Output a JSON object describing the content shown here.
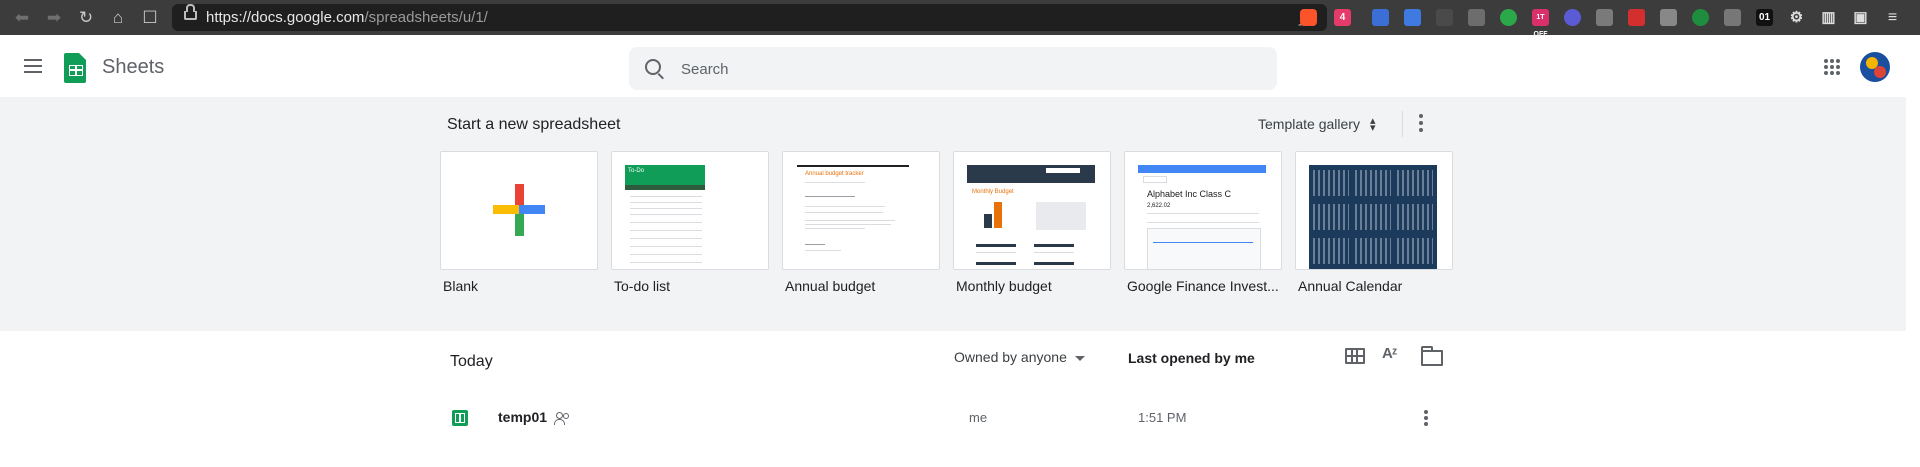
{
  "browser": {
    "url_host": "https://docs.google.com",
    "url_path": "/spreadsheets/u/1/",
    "extension_badges": {
      "brave_alerts": "4",
      "toggle": "1T OFF",
      "counter": "01"
    }
  },
  "header": {
    "app_name": "Sheets",
    "search_placeholder": "Search",
    "icons": [
      "menu-icon",
      "sheets-logo",
      "search-icon",
      "apps-grid-icon",
      "account-avatar"
    ]
  },
  "templates": {
    "title": "Start a new spreadsheet",
    "gallery_label": "Template gallery",
    "items": [
      {
        "label": "Blank"
      },
      {
        "label": "To-do list",
        "thumb_heading": "To-Do"
      },
      {
        "label": "Annual budget",
        "thumb_heading": "Annual budget tracker"
      },
      {
        "label": "Monthly budget",
        "thumb_heading": "Monthly Budget"
      },
      {
        "label": "Google Finance Invest...",
        "thumb_heading": "Alphabet Inc Class C",
        "thumb_value": "2,622.02"
      },
      {
        "label": "Annual Calendar"
      }
    ]
  },
  "files": {
    "section_title": "Today",
    "owner_filter": "Owned by anyone",
    "sort_label": "Last opened by me",
    "rows": [
      {
        "name": "temp01",
        "owner": "me",
        "last_opened": "1:51 PM"
      }
    ]
  },
  "colors": {
    "brand_green": "#0f9d58",
    "band_bg": "#f1f3f4",
    "accent_orange": "#e8710a",
    "calendar_navy": "#1b3a5c"
  }
}
